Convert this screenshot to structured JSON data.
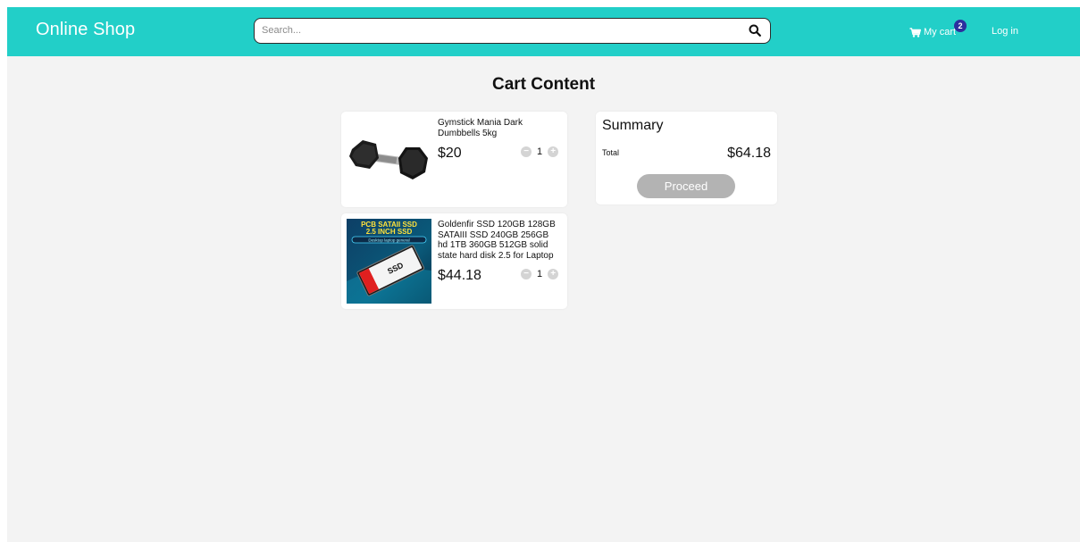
{
  "header": {
    "brand": "Online Shop",
    "search": {
      "placeholder": "Search...",
      "value": ""
    },
    "cart": {
      "label": "My cart",
      "count": "2"
    },
    "login_label": "Log in",
    "colors": {
      "bar": "#22cfc8",
      "badge": "#2c2f9e"
    }
  },
  "page_title": "Cart Content",
  "cart_items": [
    {
      "name": "Gymstick Mania Dark Dumbbells 5kg",
      "price": "$20",
      "quantity": "1",
      "image": "dumbbell-image"
    },
    {
      "name": "Goldenfir SSD 120GB 128GB SATAIII SSD 240GB 256GB hd 1TB 360GB 512GB solid state hard disk 2.5 for Laptop",
      "price": "$44.18",
      "quantity": "1",
      "image": "ssd-image"
    }
  ],
  "ssd_image_text": {
    "line1": "PCB SATAII SSD",
    "line2": "2.5 INCH SSD",
    "tag1": "Desktop laptop general",
    "tag2": "SSD"
  },
  "summary": {
    "title": "Summary",
    "total_label": "Total",
    "total_value": "$64.18",
    "proceed_label": "Proceed"
  }
}
